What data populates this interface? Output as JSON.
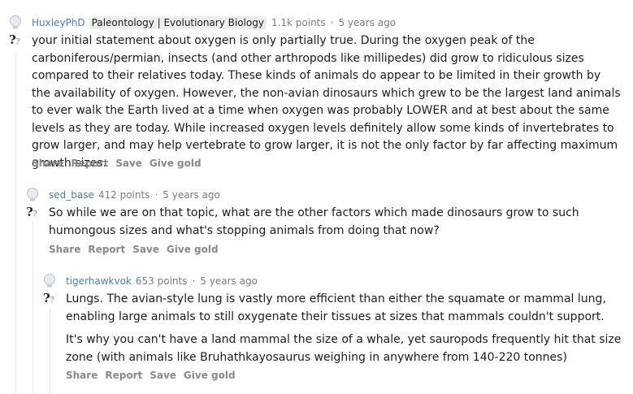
{
  "comments": [
    {
      "author": "HuxleyPhD",
      "flair": "Paleontology | Evolutionary Biology",
      "points": "1.1k points",
      "separator": "·",
      "age": "5 years ago",
      "paragraphs": [
        "your initial statement about oxygen is only partially true. During the oxygen peak of the carboniferous/permian, insects (and other arthropods like millipedes) did grow to ridiculous sizes compared to their relatives today. These kinds of animals do appear to be limited in their growth by the availability of oxygen. However, the non-avian dinosaurs which grew to be the largest land animals to ever walk the Earth lived at a time when oxygen was probably LOWER and at best about the same levels as they are today. While increased oxygen levels definitely allow some kinds of invertebrates to grow larger, and may help vertebrate to grow larger, it is not the only factor by far affecting maximum growth sizes."
      ],
      "actions": [
        "Share",
        "Report",
        "Save",
        "Give gold"
      ]
    },
    {
      "author": "sed_base",
      "flair": "",
      "points": "412 points",
      "separator": "·",
      "age": "5 years ago",
      "paragraphs": [
        "So while we are on that topic, what are the other factors which made dinosaurs grow to such humongous sizes and what's stopping animals from doing that now?"
      ],
      "actions": [
        "Share",
        "Report",
        "Save",
        "Give gold"
      ]
    },
    {
      "author": "tigerhawkvok",
      "flair": "",
      "points": "653 points",
      "separator": "·",
      "age": "5 years ago",
      "paragraphs": [
        "Lungs. The avian-style lung is vastly more efficient than either the squamate or mammal lung, enabling large animals to still oxygenate their tissues at sizes that mammals couldn't support.",
        "It's why you can't have a land mammal the size of a whale, yet sauropods frequently hit that size zone (with animals like Bruhathkayosaurus weighing in anywhere from 140-220 tonnes)"
      ],
      "actions": [
        "Share",
        "Report",
        "Save",
        "Give gold"
      ]
    }
  ],
  "icons": {
    "vote": "lightbulb-icon",
    "question": "question-mark-icon"
  },
  "colors": {
    "author": "#4a7fc1",
    "meta": "#7c7c7c",
    "actions": "#878a8c",
    "flair_bg": "#ededed"
  }
}
